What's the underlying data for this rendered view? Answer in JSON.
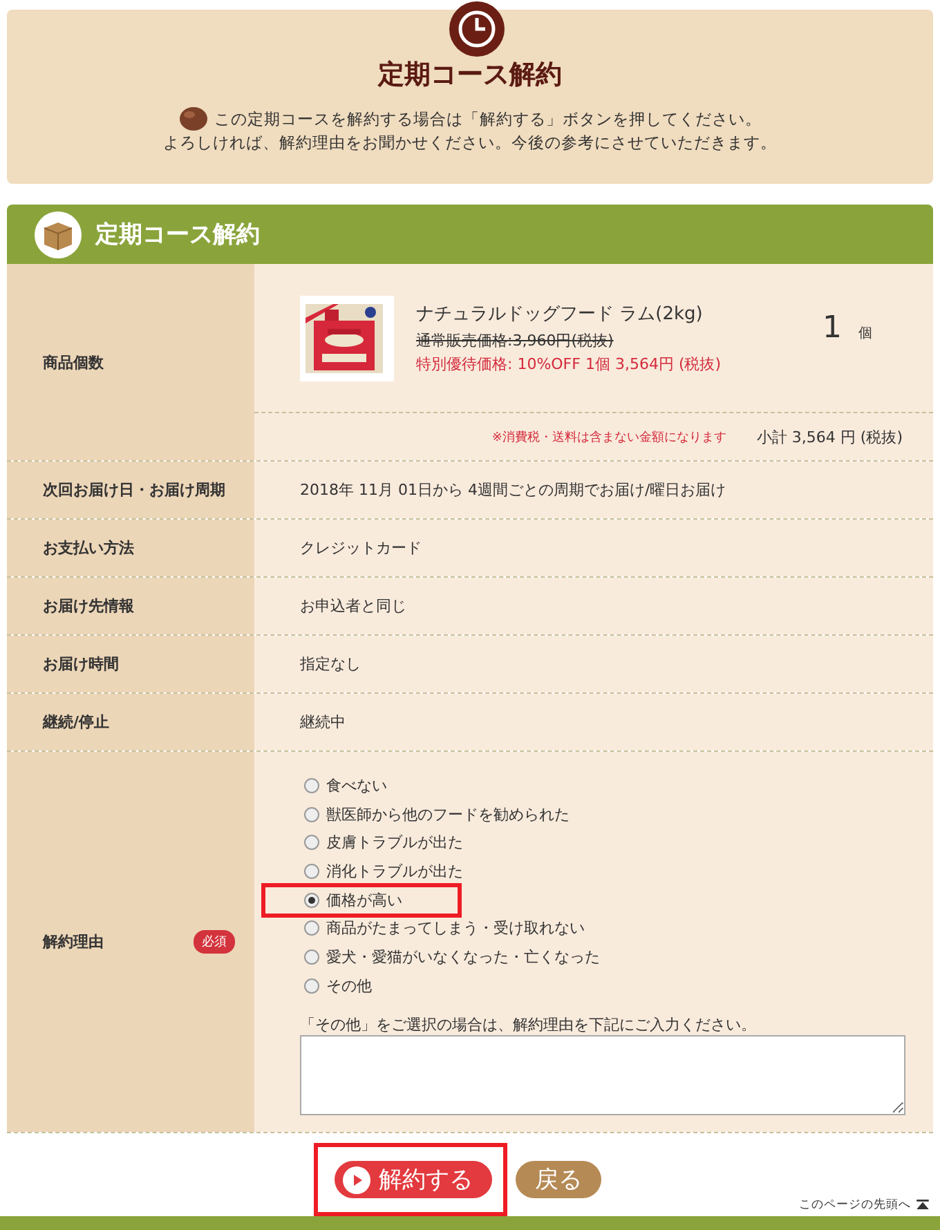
{
  "intro": {
    "title": "定期コース解約",
    "lines": [
      "この定期コースを解約する場合は「解約する」ボタンを押してください。",
      "よろしければ、解約理由をお聞かせください。今後の参考にさせていただきます。"
    ]
  },
  "section": {
    "title": "定期コース解約"
  },
  "product": {
    "label": "商品個数",
    "name": "ナチュラルドッグフード ラム(2kg)",
    "regular_price": "通常販売価格:3,960円(税抜)",
    "special_price": "特別優待価格: 10%OFF 1個 3,564円 (税抜)",
    "quantity": "1",
    "unit": "個",
    "note": "※消費税・送料は含まない金額になります",
    "subtotal": "小計 3,564 円 (税抜)"
  },
  "rows": [
    {
      "label": "次回お届け日・お届け周期",
      "value": "2018年 11月 01日から 4週間ごとの周期でお届け/曜日お届け"
    },
    {
      "label": "お支払い方法",
      "value": "クレジットカード"
    },
    {
      "label": "お届け先情報",
      "value": "お申込者と同じ"
    },
    {
      "label": "お届け時間",
      "value": "指定なし"
    },
    {
      "label": "継続/停止",
      "value": "継続中"
    }
  ],
  "reason": {
    "label": "解約理由",
    "required": "必須",
    "options": [
      {
        "label": "食べない",
        "selected": false,
        "highlighted": false
      },
      {
        "label": "獣医師から他のフードを勧められた",
        "selected": false,
        "highlighted": false
      },
      {
        "label": "皮膚トラブルが出た",
        "selected": false,
        "highlighted": false
      },
      {
        "label": "消化トラブルが出た",
        "selected": false,
        "highlighted": false
      },
      {
        "label": "価格が高い",
        "selected": true,
        "highlighted": true
      },
      {
        "label": "商品がたまってしまう・受け取れない",
        "selected": false,
        "highlighted": false
      },
      {
        "label": "愛犬・愛猫がいなくなった・亡くなった",
        "selected": false,
        "highlighted": false
      },
      {
        "label": "その他",
        "selected": false,
        "highlighted": false
      }
    ],
    "other_hint": "「その他」をご選択の場合は、解約理由を下記にご入力ください。"
  },
  "buttons": [
    {
      "kind": "primary",
      "label": "解約する",
      "highlighted": true
    },
    {
      "kind": "secondary",
      "label": "戻る",
      "highlighted": false
    }
  ],
  "page_top": "このページの先頭へ"
}
